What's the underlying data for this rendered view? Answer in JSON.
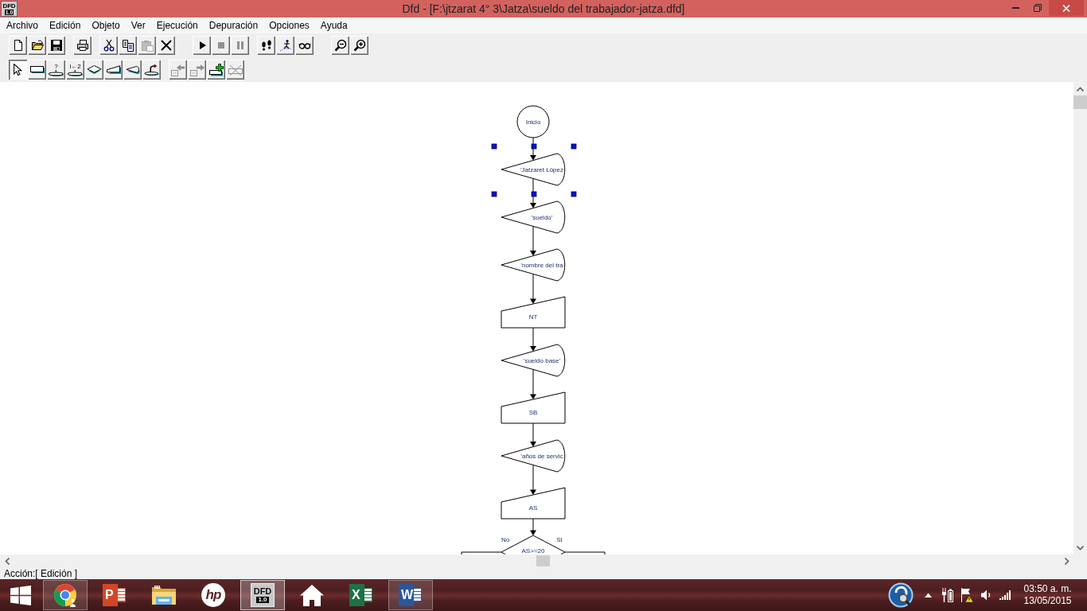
{
  "window": {
    "app_icon": {
      "label": "DFD",
      "version": "1.0"
    },
    "title": "Dfd - [F:\\jtzarat 4° 3\\Jatza\\sueldo del trabajador-jatza.dfd]"
  },
  "menu": [
    "Archivo",
    "Edición",
    "Objeto",
    "Ver",
    "Ejecución",
    "Depuración",
    "Opciones",
    "Ayuda"
  ],
  "toolbar": {
    "groups": [
      {
        "buttons": [
          {
            "kind": "new",
            "disabled": false
          },
          {
            "kind": "open",
            "disabled": false
          },
          {
            "kind": "save",
            "disabled": false
          }
        ]
      },
      {
        "buttons": [
          {
            "kind": "print",
            "disabled": false
          }
        ]
      },
      {
        "buttons": [
          {
            "kind": "cut",
            "disabled": false
          },
          {
            "kind": "copy",
            "disabled": false
          },
          {
            "kind": "paste",
            "disabled": true
          },
          {
            "kind": "delete",
            "disabled": false
          }
        ]
      },
      {
        "buttons": [
          {
            "kind": "run",
            "disabled": false
          },
          {
            "kind": "stop",
            "disabled": true
          },
          {
            "kind": "pause",
            "disabled": true
          }
        ]
      },
      {
        "buttons": [
          {
            "kind": "step",
            "disabled": false
          },
          {
            "kind": "trace",
            "disabled": false
          },
          {
            "kind": "watch",
            "disabled": false
          }
        ]
      },
      {
        "buttons": [
          {
            "kind": "zoom_out",
            "disabled": false
          },
          {
            "kind": "zoom_in",
            "disabled": false
          }
        ]
      }
    ]
  },
  "object_toolbar": {
    "tools": [
      {
        "kind": "cursor",
        "selected": true
      },
      {
        "kind": "assignment",
        "selected": false
      },
      {
        "kind": "while",
        "label": "?",
        "selected": false
      },
      {
        "kind": "for",
        "label": "i←2",
        "selected": false
      },
      {
        "kind": "decision",
        "selected": false
      },
      {
        "kind": "read",
        "selected": false
      },
      {
        "kind": "write",
        "selected": false
      },
      {
        "kind": "call",
        "selected": false
      }
    ],
    "actions": [
      {
        "kind": "move_left",
        "disabled": true
      },
      {
        "kind": "move_right",
        "disabled": true
      },
      {
        "kind": "insert",
        "disabled": false
      },
      {
        "kind": "remove",
        "disabled": true
      }
    ]
  },
  "flowchart": {
    "nodes": [
      {
        "kind": "start",
        "text": "Inicio",
        "selected": false
      },
      {
        "kind": "output",
        "text": "'Jatzaret López",
        "selected": true
      },
      {
        "kind": "output",
        "text": "'sueldo'",
        "selected": false
      },
      {
        "kind": "output",
        "text": "'nombre del tra",
        "selected": false
      },
      {
        "kind": "input",
        "text": "NT",
        "selected": false
      },
      {
        "kind": "output",
        "text": "'sueldo base'",
        "selected": false
      },
      {
        "kind": "input",
        "text": "SB",
        "selected": false
      },
      {
        "kind": "output",
        "text": "'años de servic",
        "selected": false
      },
      {
        "kind": "input",
        "text": "AS",
        "selected": false
      },
      {
        "kind": "decision",
        "text": "AS>=20",
        "no_label": "No",
        "yes_label": "SI",
        "selected": false
      }
    ]
  },
  "status_bar": {
    "text": "Acción:[ Edición ]"
  },
  "taskbar": {
    "apps": [
      {
        "kind": "browser",
        "open": true,
        "active": false
      },
      {
        "kind": "slides",
        "label": "P",
        "open": false,
        "active": false
      },
      {
        "kind": "folder",
        "open": false,
        "active": false
      },
      {
        "kind": "circle_logo",
        "label": "hp",
        "open": false,
        "active": false
      },
      {
        "kind": "dfd",
        "label": "DFD",
        "version": "1.0",
        "open": true,
        "active": true
      },
      {
        "kind": "home",
        "open": false,
        "active": false
      },
      {
        "kind": "sheet",
        "label": "X",
        "open": false,
        "active": false
      },
      {
        "kind": "doc",
        "label": "W",
        "open": true,
        "active": false
      }
    ],
    "time": "03:50 a. m.",
    "date": "13/05/2015"
  }
}
